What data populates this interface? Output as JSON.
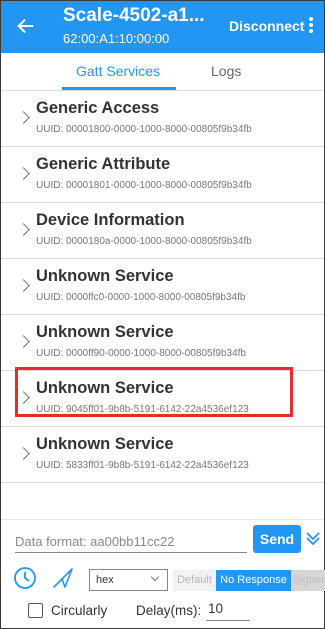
{
  "appbar": {
    "title": "Scale-4502-a1...",
    "subtitle": "62:00:A1:10:00:00",
    "disconnect_label": "Disconnect",
    "color": "#2196f3"
  },
  "tabs": [
    {
      "label": "Gatt Services",
      "active": true
    },
    {
      "label": "Logs",
      "active": false
    }
  ],
  "services": [
    {
      "name": "Generic Access",
      "uuid": "UUID: 00001800-0000-1000-8000-00805f9b34fb"
    },
    {
      "name": "Generic Attribute",
      "uuid": "UUID: 00001801-0000-1000-8000-00805f9b34fb"
    },
    {
      "name": "Device Information",
      "uuid": "UUID: 0000180a-0000-1000-8000-00805f9b34fb"
    },
    {
      "name": "Unknown Service",
      "uuid": "UUID: 0000ffc0-0000-1000-8000-00805f9b34fb"
    },
    {
      "name": "Unknown Service",
      "uuid": "UUID: 0000ff90-0000-1000-8000-00805f9b34fb"
    },
    {
      "name": "Unknown Service",
      "uuid": "UUID: 9045ff01-9b8b-5191-6142-22a4536ef123",
      "highlighted": true
    },
    {
      "name": "Unknown Service",
      "uuid": "UUID: 5833ff01-9b8b-5191-6142-22a4536ef123"
    }
  ],
  "bottom": {
    "data_placeholder": "Data format: aa00bb11cc22",
    "send_label": "Send",
    "format_value": "hex",
    "modes": [
      "Default",
      "No Response",
      "Signed"
    ],
    "selected_mode": "No Response",
    "circularly_label": "Circularly",
    "circularly_checked": false,
    "delay_label": "Delay(ms):",
    "delay_value": "10"
  },
  "icons": {
    "back": "arrow-left-icon",
    "more": "more-vertical-icon",
    "expand": "double-chevron-down-icon",
    "clock": "clock-icon",
    "send": "send-icon"
  },
  "highlight_color": "#e52b2b"
}
